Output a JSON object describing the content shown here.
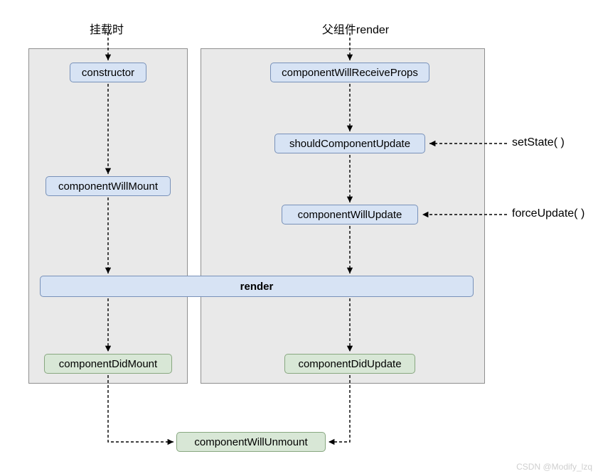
{
  "titles": {
    "left": "挂载时",
    "right": "父组件render"
  },
  "boxes": {
    "constructor": "constructor",
    "componentWillMount": "componentWillMount",
    "componentWillReceiveProps": "componentWillReceiveProps",
    "shouldComponentUpdate": "shouldComponentUpdate",
    "componentWillUpdate": "componentWillUpdate",
    "render": "render",
    "componentDidMount": "componentDidMount",
    "componentDidUpdate": "componentDidUpdate",
    "componentWillUnmount": "componentWillUnmount"
  },
  "external": {
    "setState": "setState( )",
    "forceUpdate": "forceUpdate( )"
  },
  "watermark": "CSDN @Modify_lzq",
  "colors": {
    "blue_fill": "#d7e3f4",
    "blue_border": "#7891b9",
    "green_fill": "#d8e7d6",
    "green_border": "#88a780",
    "panel_fill": "#e9e9e9",
    "panel_border": "#8f8f8f"
  },
  "chart_data": {
    "type": "table",
    "title": "React lifecycle (legacy) flow",
    "nodes": [
      {
        "id": "title_left",
        "label": "挂载时",
        "type": "label"
      },
      {
        "id": "title_right",
        "label": "父组件render",
        "type": "label"
      },
      {
        "id": "constructor",
        "label": "constructor",
        "type": "blue"
      },
      {
        "id": "componentWillMount",
        "label": "componentWillMount",
        "type": "blue"
      },
      {
        "id": "componentWillReceiveProps",
        "label": "componentWillReceiveProps",
        "type": "blue"
      },
      {
        "id": "shouldComponentUpdate",
        "label": "shouldComponentUpdate",
        "type": "blue"
      },
      {
        "id": "componentWillUpdate",
        "label": "componentWillUpdate",
        "type": "blue"
      },
      {
        "id": "render",
        "label": "render",
        "type": "blue_wide"
      },
      {
        "id": "componentDidMount",
        "label": "componentDidMount",
        "type": "green"
      },
      {
        "id": "componentDidUpdate",
        "label": "componentDidUpdate",
        "type": "green"
      },
      {
        "id": "componentWillUnmount",
        "label": "componentWillUnmount",
        "type": "green"
      },
      {
        "id": "setState",
        "label": "setState( )",
        "type": "external"
      },
      {
        "id": "forceUpdate",
        "label": "forceUpdate( )",
        "type": "external"
      }
    ],
    "edges": [
      {
        "from": "title_left",
        "to": "constructor",
        "style": "dashed"
      },
      {
        "from": "constructor",
        "to": "componentWillMount",
        "style": "dashed"
      },
      {
        "from": "componentWillMount",
        "to": "render",
        "style": "dashed"
      },
      {
        "from": "render",
        "to": "componentDidMount",
        "style": "dashed"
      },
      {
        "from": "componentDidMount",
        "to": "componentWillUnmount",
        "style": "dashed"
      },
      {
        "from": "title_right",
        "to": "componentWillReceiveProps",
        "style": "dashed"
      },
      {
        "from": "componentWillReceiveProps",
        "to": "shouldComponentUpdate",
        "style": "dashed"
      },
      {
        "from": "shouldComponentUpdate",
        "to": "componentWillUpdate",
        "style": "dashed"
      },
      {
        "from": "componentWillUpdate",
        "to": "render",
        "style": "dashed"
      },
      {
        "from": "render",
        "to": "componentDidUpdate",
        "style": "dashed"
      },
      {
        "from": "componentDidUpdate",
        "to": "componentWillUnmount",
        "style": "dashed"
      },
      {
        "from": "setState",
        "to": "shouldComponentUpdate",
        "style": "dashed"
      },
      {
        "from": "forceUpdate",
        "to": "componentWillUpdate",
        "style": "dashed"
      }
    ]
  }
}
